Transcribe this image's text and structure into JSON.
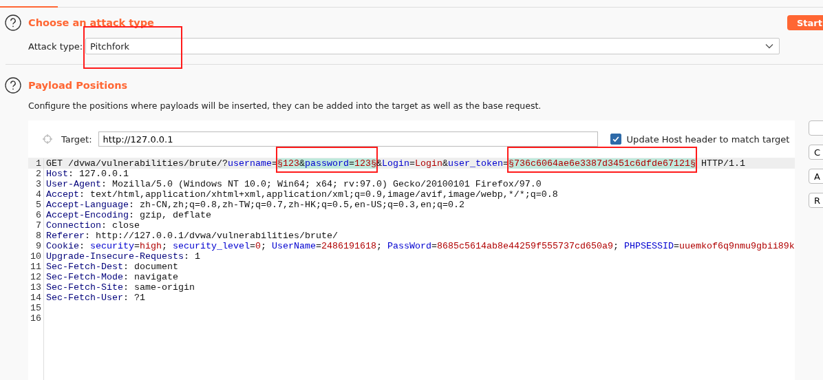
{
  "tabs": {
    "active_indicator": true
  },
  "attack_section": {
    "title": "Choose an attack type",
    "start_button": "Start",
    "label": "Attack type:",
    "value": "Pitchfork",
    "annotated": true
  },
  "positions_section": {
    "title": "Payload Positions",
    "description": "Configure the positions where payloads will be inserted, they can be added into the target as well as the base request.",
    "target_label": "Target:",
    "target_value": "http://127.0.0.1",
    "update_host": {
      "label": "Update Host header to match target",
      "checked": true
    }
  },
  "side_buttons": [
    {
      "label": "C"
    },
    {
      "label": "A"
    },
    {
      "label": "R"
    }
  ],
  "lines": [
    {
      "number": "1",
      "current": true,
      "groups": [
        {
          "marked": false,
          "annotated": false,
          "segments": [
            {
              "kind": "text",
              "text": "GET /dvwa/vulnerabilities/brute/?"
            },
            {
              "kind": "param",
              "text": "username"
            },
            {
              "kind": "text",
              "text": "="
            }
          ]
        },
        {
          "marked": true,
          "annotated": true,
          "segments": [
            {
              "kind": "value",
              "text": "§123"
            },
            {
              "kind": "text",
              "text": "&"
            },
            {
              "kind": "param",
              "text": "password"
            },
            {
              "kind": "text",
              "text": "="
            },
            {
              "kind": "value",
              "text": "123§"
            }
          ]
        },
        {
          "marked": false,
          "annotated": false,
          "segments": [
            {
              "kind": "text",
              "text": "&"
            },
            {
              "kind": "param",
              "text": "Login"
            },
            {
              "kind": "text",
              "text": "="
            },
            {
              "kind": "value",
              "text": "Login"
            },
            {
              "kind": "text",
              "text": "&"
            },
            {
              "kind": "param",
              "text": "user_token"
            },
            {
              "kind": "text",
              "text": "="
            }
          ]
        },
        {
          "marked": true,
          "annotated": true,
          "segments": [
            {
              "kind": "value",
              "text": "§736c6064ae6e3387d3451c6dfde67121§"
            }
          ]
        },
        {
          "marked": false,
          "annotated": false,
          "segments": [
            {
              "kind": "text",
              "text": " HTTP/1.1"
            }
          ]
        }
      ]
    },
    {
      "number": "2",
      "current": false,
      "groups": [
        {
          "marked": false,
          "annotated": false,
          "segments": [
            {
              "kind": "header",
              "text": "Host"
            },
            {
              "kind": "text",
              "text": ": 127.0.0.1"
            }
          ]
        }
      ]
    },
    {
      "number": "3",
      "current": false,
      "groups": [
        {
          "marked": false,
          "annotated": false,
          "segments": [
            {
              "kind": "header",
              "text": "User-Agent"
            },
            {
              "kind": "text",
              "text": ": Mozilla/5.0 (Windows NT 10.0; Win64; x64; rv:97.0) Gecko/20100101 Firefox/97.0"
            }
          ]
        }
      ]
    },
    {
      "number": "4",
      "current": false,
      "groups": [
        {
          "marked": false,
          "annotated": false,
          "segments": [
            {
              "kind": "header",
              "text": "Accept"
            },
            {
              "kind": "text",
              "text": ": text/html,application/xhtml+xml,application/xml;q=0.9,image/avif,image/webp,*/*;q=0.8"
            }
          ]
        }
      ]
    },
    {
      "number": "5",
      "current": false,
      "groups": [
        {
          "marked": false,
          "annotated": false,
          "segments": [
            {
              "kind": "header",
              "text": "Accept-Language"
            },
            {
              "kind": "text",
              "text": ": zh-CN,zh;q=0.8,zh-TW;q=0.7,zh-HK;q=0.5,en-US;q=0.3,en;q=0.2"
            }
          ]
        }
      ]
    },
    {
      "number": "6",
      "current": false,
      "groups": [
        {
          "marked": false,
          "annotated": false,
          "segments": [
            {
              "kind": "header",
              "text": "Accept-Encoding"
            },
            {
              "kind": "text",
              "text": ": gzip, deflate"
            }
          ]
        }
      ]
    },
    {
      "number": "7",
      "current": false,
      "groups": [
        {
          "marked": false,
          "annotated": false,
          "segments": [
            {
              "kind": "header",
              "text": "Connection"
            },
            {
              "kind": "text",
              "text": ": close"
            }
          ]
        }
      ]
    },
    {
      "number": "8",
      "current": false,
      "groups": [
        {
          "marked": false,
          "annotated": false,
          "segments": [
            {
              "kind": "header",
              "text": "Referer"
            },
            {
              "kind": "text",
              "text": ": http://127.0.0.1/dvwa/vulnerabilities/brute/"
            }
          ]
        }
      ]
    },
    {
      "number": "9",
      "current": false,
      "groups": [
        {
          "marked": false,
          "annotated": false,
          "segments": [
            {
              "kind": "header",
              "text": "Cookie"
            },
            {
              "kind": "text",
              "text": ": "
            },
            {
              "kind": "param",
              "text": "security"
            },
            {
              "kind": "text",
              "text": "="
            },
            {
              "kind": "value",
              "text": "high"
            },
            {
              "kind": "text",
              "text": "; "
            },
            {
              "kind": "param",
              "text": "security_level"
            },
            {
              "kind": "text",
              "text": "="
            },
            {
              "kind": "value",
              "text": "0"
            },
            {
              "kind": "text",
              "text": "; "
            },
            {
              "kind": "param",
              "text": "UserName"
            },
            {
              "kind": "text",
              "text": "="
            },
            {
              "kind": "value",
              "text": "2486191618"
            },
            {
              "kind": "text",
              "text": "; "
            },
            {
              "kind": "param",
              "text": "PassWord"
            },
            {
              "kind": "text",
              "text": "="
            },
            {
              "kind": "value",
              "text": "8685c5614ab8e44259f555737cd650a9"
            },
            {
              "kind": "text",
              "text": "; "
            },
            {
              "kind": "param",
              "text": "PHPSESSID"
            },
            {
              "kind": "text",
              "text": "="
            },
            {
              "kind": "value",
              "text": "uuemkof6q9nmu9gbii89k"
            }
          ]
        }
      ]
    },
    {
      "number": "10",
      "current": false,
      "groups": [
        {
          "marked": false,
          "annotated": false,
          "segments": [
            {
              "kind": "header",
              "text": "Upgrade-Insecure-Requests"
            },
            {
              "kind": "text",
              "text": ": 1"
            }
          ]
        }
      ]
    },
    {
      "number": "11",
      "current": false,
      "groups": [
        {
          "marked": false,
          "annotated": false,
          "segments": [
            {
              "kind": "header",
              "text": "Sec-Fetch-Dest"
            },
            {
              "kind": "text",
              "text": ": document"
            }
          ]
        }
      ]
    },
    {
      "number": "12",
      "current": false,
      "groups": [
        {
          "marked": false,
          "annotated": false,
          "segments": [
            {
              "kind": "header",
              "text": "Sec-Fetch-Mode"
            },
            {
              "kind": "text",
              "text": ": navigate"
            }
          ]
        }
      ]
    },
    {
      "number": "13",
      "current": false,
      "groups": [
        {
          "marked": false,
          "annotated": false,
          "segments": [
            {
              "kind": "header",
              "text": "Sec-Fetch-Site"
            },
            {
              "kind": "text",
              "text": ": same-origin"
            }
          ]
        }
      ]
    },
    {
      "number": "14",
      "current": false,
      "groups": [
        {
          "marked": false,
          "annotated": false,
          "segments": [
            {
              "kind": "header",
              "text": "Sec-Fetch-User"
            },
            {
              "kind": "text",
              "text": ": ?1"
            }
          ]
        }
      ]
    },
    {
      "number": "15",
      "current": false
    },
    {
      "number": "16",
      "current": false
    }
  ]
}
